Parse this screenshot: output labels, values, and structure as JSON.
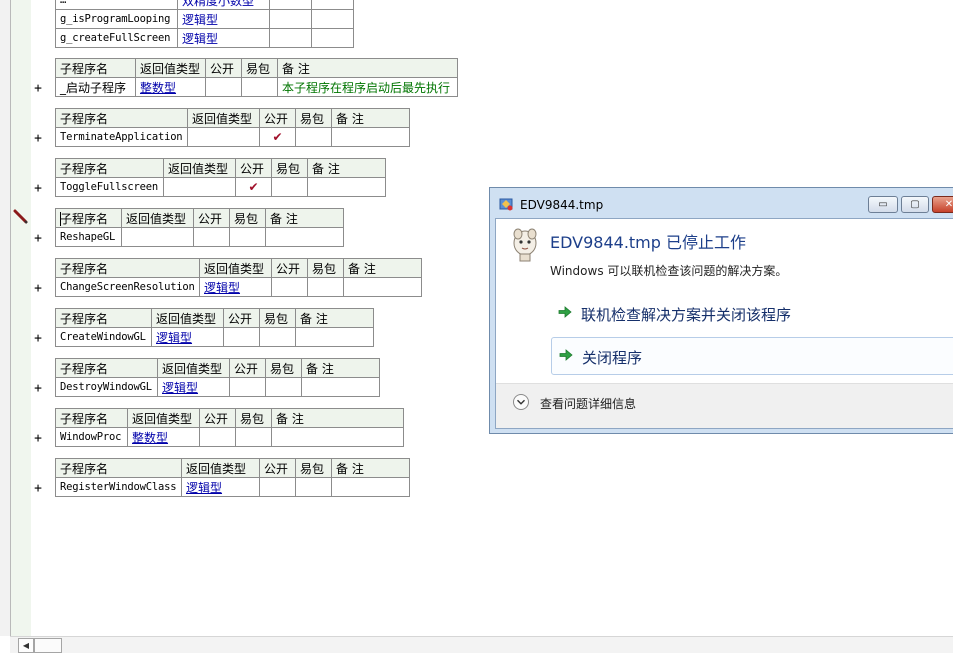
{
  "header": {
    "sub_name": "子程序名",
    "return_type": "返回值类型",
    "public": "公开",
    "easy_pkg": "易包",
    "remark": "备 注"
  },
  "plus_sign": "+",
  "check_mark": "✔",
  "globals_table": {
    "partial_row": {
      "name": "…",
      "type": "双精度小数型"
    },
    "rows": [
      {
        "name": "g_isProgramLooping",
        "type": "逻辑型"
      },
      {
        "name": "g_createFullScreen",
        "type": "逻辑型"
      }
    ]
  },
  "subs": [
    {
      "name": "_启动子程序",
      "type": "整数型",
      "public": "",
      "note": "本子程序在程序启动后最先执行",
      "name_mono": false
    },
    {
      "name": "TerminateApplication",
      "type": "",
      "public": "✔",
      "note": ""
    },
    {
      "name": "ToggleFullscreen",
      "type": "",
      "public": "✔",
      "note": ""
    },
    {
      "name": "ReshapeGL",
      "type": "",
      "public": "",
      "note": ""
    },
    {
      "name": "ChangeScreenResolution",
      "type": "逻辑型",
      "public": "",
      "note": ""
    },
    {
      "name": "CreateWindowGL",
      "type": "逻辑型",
      "public": "",
      "note": ""
    },
    {
      "name": "DestroyWindowGL",
      "type": "逻辑型",
      "public": "",
      "note": ""
    },
    {
      "name": "WindowProc",
      "type": "整数型",
      "public": "",
      "note": ""
    },
    {
      "name": "RegisterWindowClass",
      "type": "逻辑型",
      "public": "",
      "note": ""
    }
  ],
  "dialog": {
    "title": "EDV9844.tmp",
    "heading": "EDV9844.tmp 已停止工作",
    "description": "Windows 可以联机检查该问题的解决方案。",
    "option_check_online": "联机检查解决方案并关闭该程序",
    "option_close": "关闭程序",
    "details": "查看问题详细信息",
    "minimize_glyph": "▭",
    "maximize_glyph": "▢",
    "close_glyph": "✕"
  },
  "scrollbar": {
    "left_arrow": "◀"
  },
  "colors": {
    "type_text": "#0000aa",
    "note_text": "#007500",
    "check": "#a0102a",
    "header_bg": "#eef4ec",
    "dialog_frame": "#cfe0f2",
    "dialog_heading": "#1d3f8a"
  }
}
